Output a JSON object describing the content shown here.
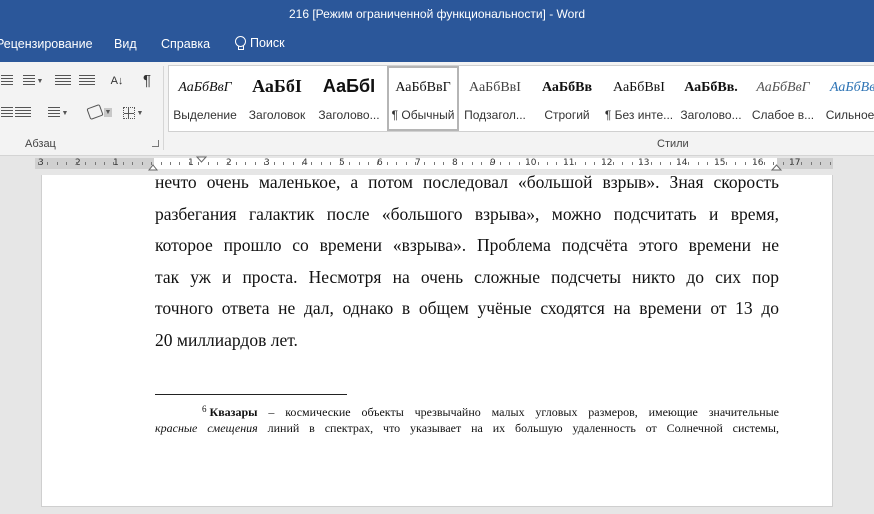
{
  "window": {
    "title": "216 [Режим ограниченной функциональности]  -  Word"
  },
  "menu": {
    "tabs": [
      "Рецензирование",
      "Вид",
      "Справка"
    ],
    "tell_me": "Поиск"
  },
  "ribbon": {
    "paragraph_group_label": "Абзац",
    "styles_group_label": "Стили",
    "pilcrow": "¶",
    "sort_symbol": "A↓",
    "styles": [
      {
        "preview": "АаБбВвГ",
        "name": "Выделение"
      },
      {
        "preview": "АаБбI",
        "name": "Заголовок"
      },
      {
        "preview": "АаБбI",
        "name": "Заголово..."
      },
      {
        "preview": "АаБбВвГ",
        "name": "¶ Обычный"
      },
      {
        "preview": "АаБбВвI",
        "name": "Подзагол..."
      },
      {
        "preview": "АаБбВв",
        "name": "Строгий"
      },
      {
        "preview": "АаБбВвI",
        "name": "¶ Без инте..."
      },
      {
        "preview": "АаБбВв.",
        "name": "Заголово..."
      },
      {
        "preview": "АаБбВвГ",
        "name": "Слабое в..."
      },
      {
        "preview": "АаБбВвІ",
        "name": "Сильное..."
      }
    ]
  },
  "ruler": {
    "left_labels": [
      "3",
      "2",
      "1"
    ],
    "right_labels": [
      "1",
      "2",
      "3",
      "4",
      "5",
      "6",
      "7",
      "8",
      "9",
      "10",
      "11",
      "12",
      "13",
      "14",
      "15",
      "16",
      "17"
    ]
  },
  "document": {
    "lines": [
      "нечто очень маленькое, а потом последовал «большой взрыв». Зная скорость",
      "разбегания галактик после «большого взрыва», можно подсчитать и время,",
      "которое прошло со времени «взрыва». Проблема подсчёта этого времени не",
      "так уж и проста. Несмотря на очень сложные подсчеты никто до сих пор",
      "точного ответа не дал, однако в общем учёные сходятся на времени от 13 до",
      "20 миллиардов лет."
    ],
    "footnote": {
      "number": "6",
      "term": "Квазары",
      "line1_rest": " – космические объекты чрезвычайно малых угловых размеров, имеющие значительные",
      "line2_italic": "красные смещения",
      "line2_rest": " линий в спектрах, что указывает на их большую удаленность от Солнечной системы,"
    }
  }
}
